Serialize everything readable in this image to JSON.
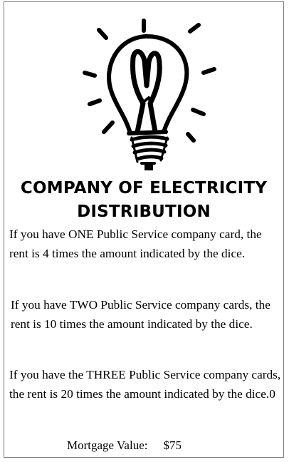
{
  "card": {
    "title_line1": "COMPANY OF ELECTRICITY",
    "title_line2": "DISTRIBUTION",
    "rule_one": "If you have ONE Public Service company card, the rent is 4 times the amount indicated by the dice.",
    "rule_two": "If you have TWO Public Service company cards, the rent is 10 times the amount indicated by the dice.",
    "rule_three": "If you have the THREE Public Service company cards, the rent is 20 times the amount indicated by the dice.0",
    "mortgage_label": "Mortgage Value:",
    "mortgage_value": "$75",
    "icon": "light-bulb-icon"
  }
}
